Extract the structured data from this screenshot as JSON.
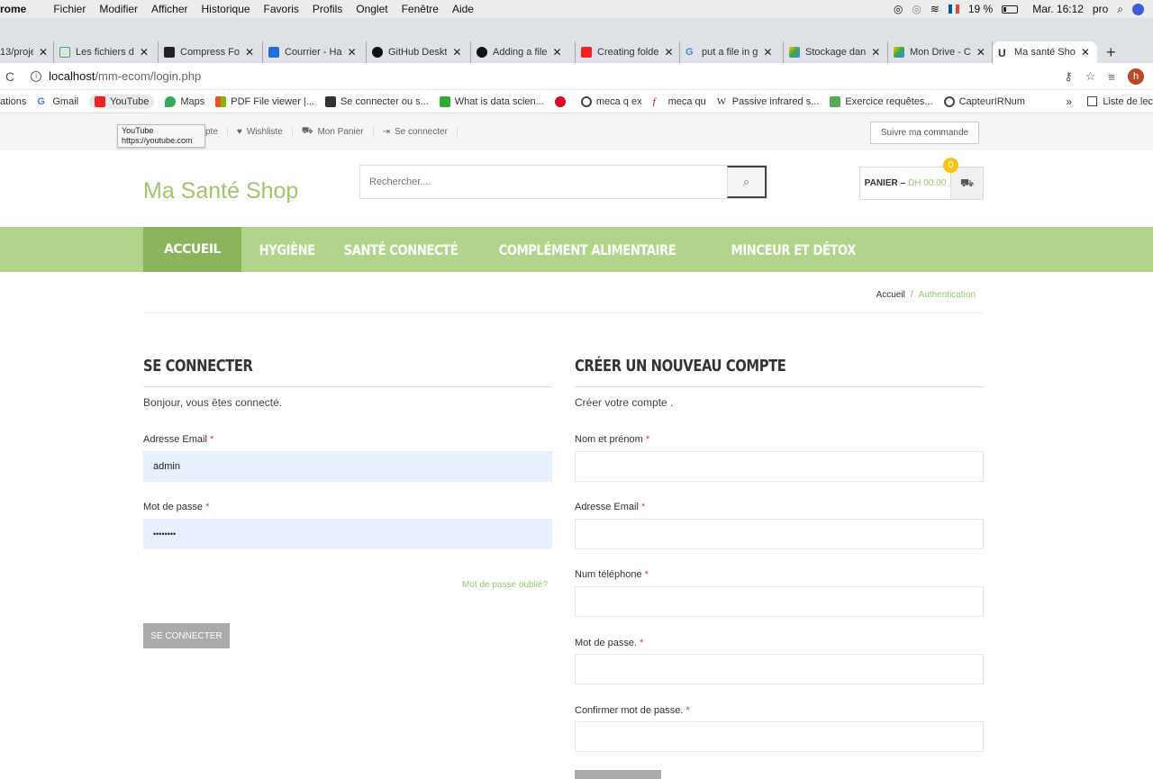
{
  "menubar": {
    "app": "rome",
    "items": [
      "Fichier",
      "Modifier",
      "Afficher",
      "Historique",
      "Favoris",
      "Profils",
      "Onglet",
      "Fenêtre",
      "Aide"
    ],
    "battery": "19 %",
    "clock": "Mar. 16:12",
    "user": "pro"
  },
  "tabs": [
    {
      "label": "13/proje",
      "icon_color": "#555"
    },
    {
      "label": "Les fichiers d",
      "icon_color": "#4a6"
    },
    {
      "label": "Compress Fo",
      "icon_color": "#222"
    },
    {
      "label": "Courrier - Ha",
      "icon_color": "#1f6fd1"
    },
    {
      "label": "GitHub Deskt",
      "icon_color": "#111"
    },
    {
      "label": "Adding a file",
      "icon_color": "#111"
    },
    {
      "label": "Creating folde",
      "icon_color": "#e22"
    },
    {
      "label": "put a file in g",
      "icon_color": "#4285f4"
    },
    {
      "label": "Stockage dan",
      "icon_color": "#fbbc05"
    },
    {
      "label": "Mon Drive - C",
      "icon_color": "#34a853"
    },
    {
      "label": "Ma santé Sho",
      "icon_color": "#333"
    }
  ],
  "address": {
    "host": "localhost",
    "path": "/mm-ecom/login.php"
  },
  "bookmarks": [
    {
      "label": "ations",
      "color": "transparent"
    },
    {
      "label": "Gmail",
      "color": "#4285f4"
    },
    {
      "label": "YouTube",
      "color": "#e22"
    },
    {
      "label": "Maps",
      "color": "#34a853"
    },
    {
      "label": "PDF File viewer |...",
      "color": "#f4b400"
    },
    {
      "label": "Se connecter ou s...",
      "color": "#333"
    },
    {
      "label": "What is data scien...",
      "color": "#3a3"
    },
    {
      "label": "",
      "color": "#e60023"
    },
    {
      "label": "meca q ex",
      "color": "#444"
    },
    {
      "label": "meca qu",
      "color": "#c00"
    },
    {
      "label": "Passive infrared s...",
      "color": "#fff"
    },
    {
      "label": "Exercice requêtes...",
      "color": "#5a5"
    },
    {
      "label": "CapteurIRNum",
      "color": "#444"
    }
  ],
  "bookmarks_more": "»",
  "reading_list": "Liste de lec",
  "tooltip": {
    "title": "YouTube",
    "url": "https://youtube.com"
  },
  "toplinks": {
    "account": "pte",
    "wishlist": "Wishliste",
    "cart": "Mon Panier",
    "login": "Se connecter"
  },
  "track_order": "Suivre ma commande",
  "logo": "Ma Santé Shop",
  "search": {
    "placeholder": "Rechercher...."
  },
  "cart": {
    "label": "PANIER –",
    "price": "DH 00.00",
    "count": "0"
  },
  "nav": [
    "ACCUEIL",
    "HYGIÈNE",
    "SANTÉ CONNECTÉ",
    "COMPLÉMENT ALIMENTAIRE",
    "MINCEUR ET DÉTOX"
  ],
  "breadcrumb": {
    "home": "Accueil",
    "sep": "/",
    "current": "Authentication"
  },
  "login": {
    "title": "SE CONNECTER",
    "message": "Bonjour, vous êtes connecté.",
    "email_label": "Adresse Email",
    "email_value": "admin",
    "password_label": "Mot de passe",
    "password_value": "••••••••",
    "forgot": "Mot de passe oublié?",
    "button": "SE CONNECTER"
  },
  "register": {
    "title": "CRÉER UN NOUVEAU COMPTE",
    "message": "Créer votre compte .",
    "name_label": "Nom et prénom",
    "email_label": "Adresse Email",
    "phone_label": "Num téléphone",
    "password_label": "Mot de passe.",
    "confirm_label": "Confirmer mot de passe."
  },
  "required_mark": "*"
}
